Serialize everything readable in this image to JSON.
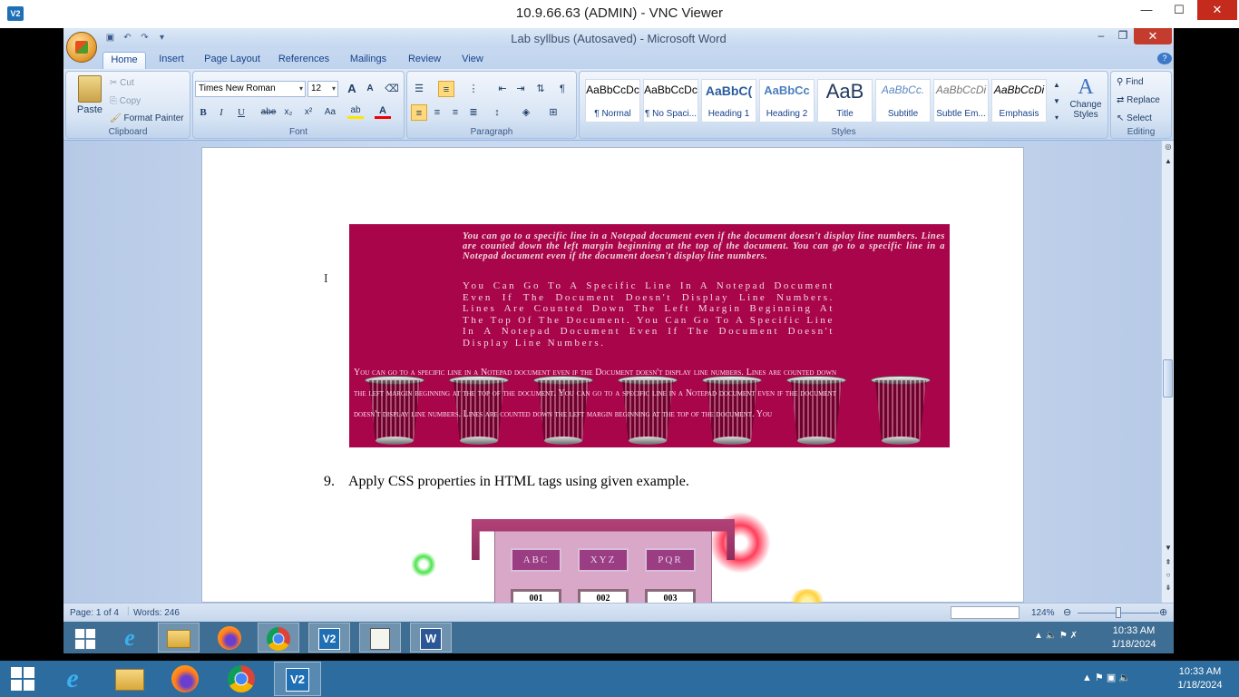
{
  "vnc": {
    "title": "10.9.66.63 (ADMIN) - VNC Viewer",
    "logo_text": "V2",
    "minimize": "—",
    "maximize": "☐",
    "close": "✕"
  },
  "word": {
    "title": "Lab syllbus (Autosaved) - Microsoft Word",
    "minimize": "–",
    "restore": "❐",
    "close": "✕",
    "help": "?"
  },
  "tabs": [
    "Home",
    "Insert",
    "Page Layout",
    "References",
    "Mailings",
    "Review",
    "View"
  ],
  "ribbon": {
    "clipboard": {
      "label": "Clipboard",
      "paste": "Paste",
      "cut": "Cut",
      "copy": "Copy",
      "format_painter": "Format Painter"
    },
    "font": {
      "label": "Font",
      "name": "Times New Roman",
      "size": "12",
      "grow": "A",
      "shrink": "A",
      "bold": "B",
      "italic": "I",
      "underline": "U",
      "strike": "abe",
      "subscript": "x₂",
      "superscript": "x²",
      "case": "Aa",
      "highlight": "ab",
      "color": "A"
    },
    "paragraph": {
      "label": "Paragraph"
    },
    "styles": {
      "label": "Styles",
      "items": [
        {
          "preview": "AaBbCcDc",
          "name": "¶ Normal"
        },
        {
          "preview": "AaBbCcDc",
          "name": "¶ No Spaci..."
        },
        {
          "preview": "AaBbC(",
          "name": "Heading 1"
        },
        {
          "preview": "AaBbCc",
          "name": "Heading 2"
        },
        {
          "preview": "AaB",
          "name": "Title"
        },
        {
          "preview": "AaBbCc.",
          "name": "Subtitle"
        },
        {
          "preview": "AaBbCcDi",
          "name": "Subtle Em..."
        },
        {
          "preview": "AaBbCcDi",
          "name": "Emphasis"
        }
      ],
      "change_styles": "Change Styles"
    },
    "editing": {
      "label": "Editing",
      "find": "Find",
      "replace": "Replace",
      "select": "Select"
    }
  },
  "document": {
    "banner_text_1": "You can go to a specific line in a Notepad document even if the document doesn't display line numbers. Lines are counted down the left margin beginning at the top of the document. You can go to a specific line in a Notepad document even if the document doesn't display line numbers.",
    "banner_text_2": "You Can Go To A Specific Line In A Notepad Document Even If The Document Doesn't Display Line Numbers. Lines Are Counted Down The Left Margin Beginning At The Top Of The Document. You Can Go To A Specific Line In A Notepad Document Even If The Document Doesn't Display Line Numbers.",
    "banner_text_3": "You can go to a specific line in a Notepad document even if the Document doesn't display line numbers. Lines are counted down the left margin beginning at the top of the document. You can go to a specific line in a Notepad document even if the document doesn't display line numbers. Lines are counted down the left margin beginning at the top of the document. You",
    "step_number": "9.",
    "step_text": "Apply CSS properties in HTML  tags using given example.",
    "table_headers": [
      "ABC",
      "XYZ",
      "PQR"
    ],
    "table_cells": [
      "001",
      "002",
      "003"
    ]
  },
  "status": {
    "page": "Page: 1 of 4",
    "words": "Words: 246",
    "zoom": "124%"
  },
  "inner_taskbar": {
    "time": "10:33 AM",
    "date": "1/18/2024"
  },
  "outer_taskbar": {
    "time": "10:33 AM",
    "date": "1/18/2024"
  },
  "colors": {
    "banner": "#a8054a",
    "vnc_close": "#c42b1c",
    "taskbar": "#2d6c9e"
  }
}
